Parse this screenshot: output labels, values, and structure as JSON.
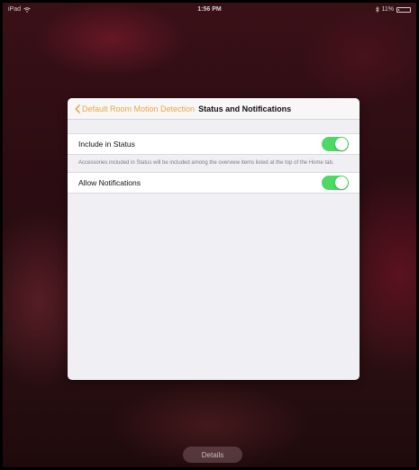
{
  "status_bar": {
    "device": "iPad",
    "time": "1:56 PM",
    "battery_percent": "11%",
    "battery_level": 0.11
  },
  "sheet": {
    "back_label": "Default Room Motion Detection",
    "title": "Status and Notifications",
    "rows": [
      {
        "label": "Include in Status",
        "on": true
      },
      {
        "label": "Allow Notifications",
        "on": true
      }
    ],
    "include_footer": "Accessories included in Status will be included among the overview items listed at the top of the Home tab."
  },
  "details_button": "Details",
  "colors": {
    "accent": "#f0a33c",
    "toggle_on": "#4cd964"
  }
}
